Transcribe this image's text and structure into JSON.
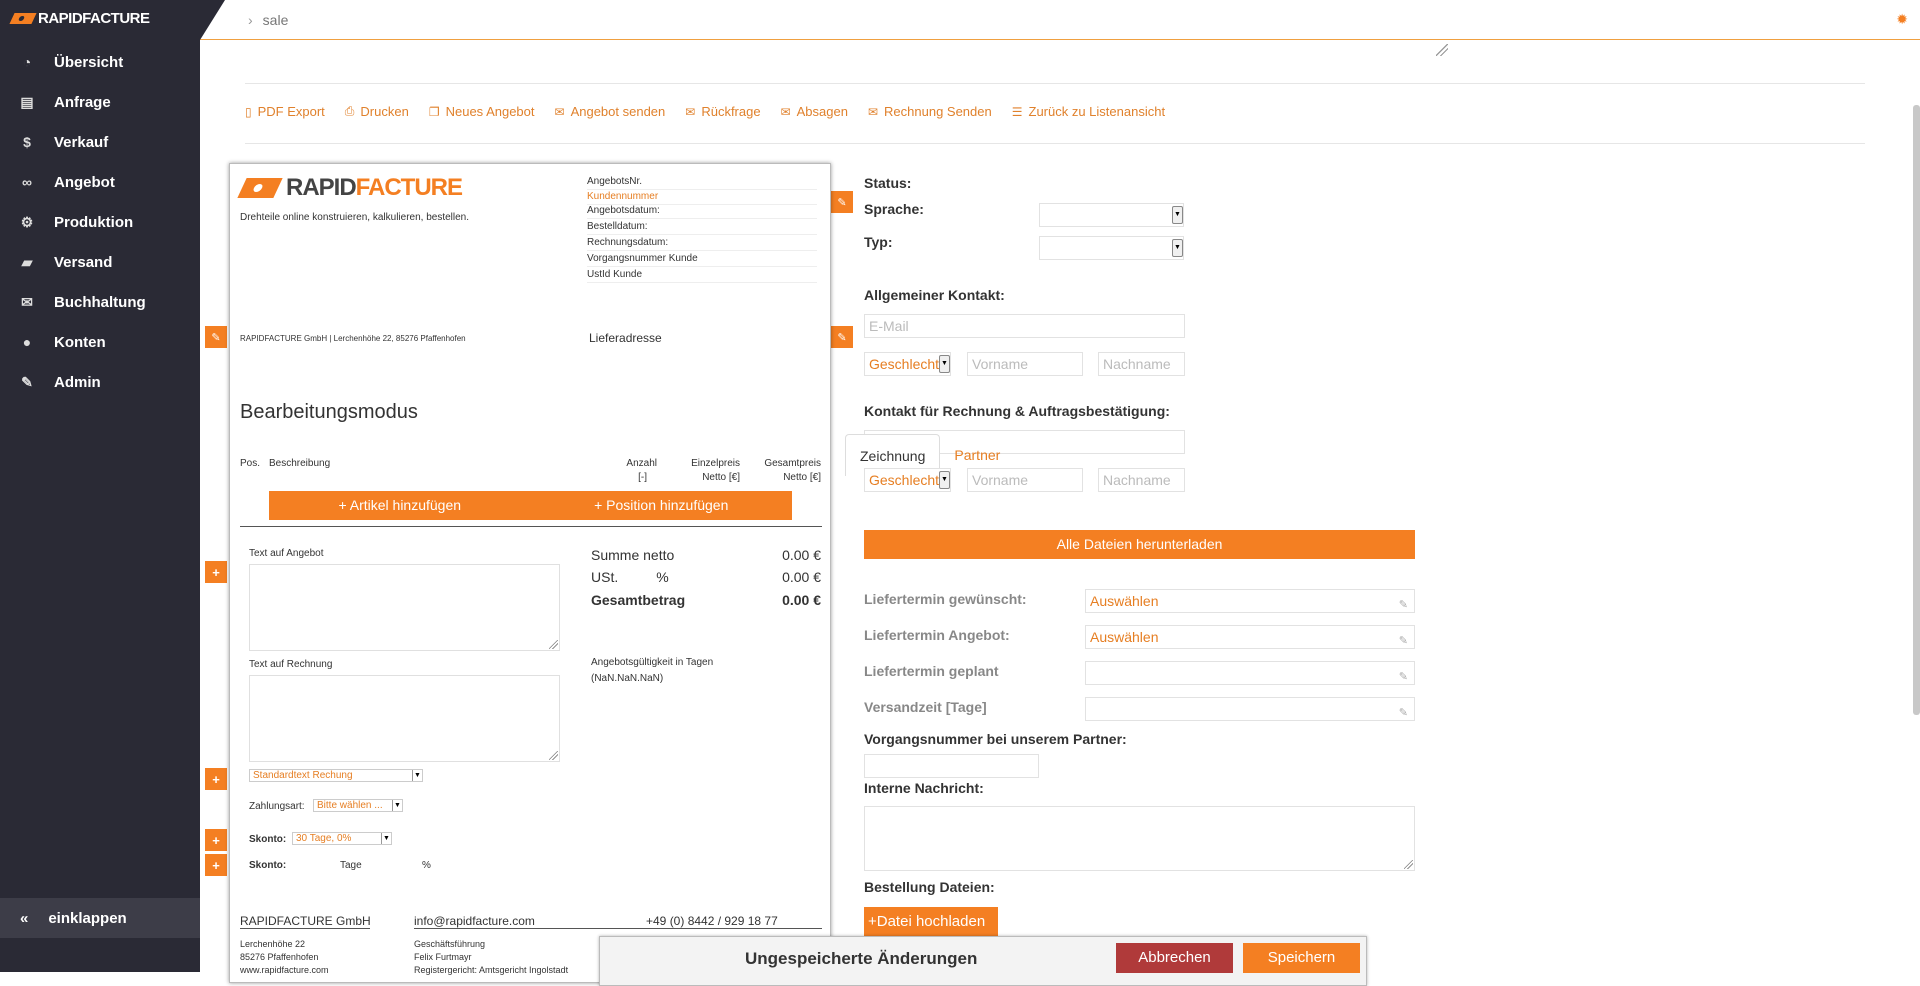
{
  "app": {
    "logo_text": "RAPIDFACTURE"
  },
  "sidebar": {
    "items": [
      {
        "label": "Übersicht",
        "icon": "pie-chart-icon"
      },
      {
        "label": "Anfrage",
        "icon": "file-icon"
      },
      {
        "label": "Verkauf",
        "icon": "dollar-icon"
      },
      {
        "label": "Angebot",
        "icon": "link-icon"
      },
      {
        "label": "Produktion",
        "icon": "gears-icon"
      },
      {
        "label": "Versand",
        "icon": "truck-icon"
      },
      {
        "label": "Buchhaltung",
        "icon": "envelope-icon"
      },
      {
        "label": "Konten",
        "icon": "user-icon"
      },
      {
        "label": "Admin",
        "icon": "wrench-icon"
      }
    ],
    "collapse_label": "einklappen"
  },
  "topbar": {
    "breadcrumb": "sale"
  },
  "actions": [
    {
      "label": "PDF Export",
      "icon": "pdf-icon"
    },
    {
      "label": "Drucken",
      "icon": "print-icon"
    },
    {
      "label": "Neues Angebot",
      "icon": "copy-icon"
    },
    {
      "label": "Angebot senden",
      "icon": "envelope-icon"
    },
    {
      "label": "Rückfrage",
      "icon": "envelope-icon"
    },
    {
      "label": "Absagen",
      "icon": "envelope-icon"
    },
    {
      "label": "Rechnung Senden",
      "icon": "envelope-icon"
    },
    {
      "label": "Zurück zu Listenansicht",
      "icon": "list-icon"
    }
  ],
  "document": {
    "logo_text_dark": "RAPID",
    "logo_text_orange": "FACTURE",
    "tagline": "Drehteile online konstruieren, kalkulieren, bestellen.",
    "meta": {
      "angebotsnr": "AngebotsNr.",
      "kundennummer": "Kundennummer",
      "angebotsdatum": "Angebotsdatum:",
      "bestelldatum": "Bestelldatum:",
      "rechnungsdatum": "Rechnungsdatum:",
      "vorgangsnummer": "Vorgangsnummer Kunde",
      "ustid": "UstId Kunde"
    },
    "sender_line": "RAPIDFACTURE GmbH | Lerchenhöhe 22, 85276 Pfaffenhofen",
    "lieferadresse": "Lieferadresse",
    "mode_title": "Bearbeitungsmodus",
    "table_headers": {
      "pos": "Pos.",
      "beschreibung": "Beschreibung",
      "anzahl": "Anzahl",
      "anzahl_unit": "[-]",
      "einzelpreis": "Einzelpreis",
      "einzelpreis_unit": "Netto [€]",
      "gesamtpreis": "Gesamtpreis",
      "gesamtpreis_unit": "Netto [€]"
    },
    "add_article": "+ Artikel hinzufügen",
    "add_position": "+ Position hinzufügen",
    "text_angebot_label": "Text auf Angebot",
    "text_rechnung_label": "Text auf Rechnung",
    "summary": {
      "netto_label": "Summe netto",
      "netto_value": "0.00 €",
      "ust_label": "USt.",
      "ust_pct": "%",
      "ust_value": "0.00 €",
      "total_label": "Gesamtbetrag",
      "total_value": "0.00 €"
    },
    "validity_label": "Angebotsgültigkeit in Tagen",
    "validity_value": "(NaN.NaN.NaN)",
    "standardtext_select": "Standardtext Rechung",
    "zahlungsart_label": "Zahlungsart:",
    "zahlungsart_select": "Bitte wählen ...",
    "skonto_label": "Skonto:",
    "skonto_select": "30 Tage, 0%",
    "skonto2_label": "Skonto:",
    "skonto2_tage": "Tage",
    "skonto2_pct": "%",
    "footer": {
      "company": "RAPIDFACTURE GmbH",
      "email": "info@rapidfacture.com",
      "phone": "+49 (0) 8442 / 929 18 77",
      "addr1": "Lerchenhöhe 22",
      "addr2": "85276 Pfaffenhofen",
      "web": "www.rapidfacture.com",
      "gf_label": "Geschäftsführung",
      "gf_name": "Felix Furtmayr",
      "register": "Registergericht: Amtsgericht Ingolstadt"
    }
  },
  "form": {
    "status_label": "Status:",
    "sprache_label": "Sprache:",
    "typ_label": "Typ:",
    "allgemeiner_kontakt": "Allgemeiner Kontakt:",
    "email_placeholder": "E-Mail",
    "geschlecht": "Geschlecht",
    "vorname_placeholder": "Vorname",
    "nachname_placeholder": "Nachname",
    "kontakt_rechnung": "Kontakt für Rechnung & Auftragsbestätigung:",
    "tabs": [
      "Zeichnung",
      "Partner"
    ],
    "download_all": "Alle Dateien herunterladen",
    "liefertermin_gewuenscht": "Liefertermin gewünscht:",
    "liefertermin_angebot": "Liefertermin Angebot:",
    "liefertermin_geplant": "Liefertermin geplant",
    "versandzeit": "Versandzeit [Tage]",
    "auswaehlen": "Auswählen",
    "vorgangsnummer_partner": "Vorgangsnummer bei unserem Partner:",
    "interne_nachricht": "Interne Nachricht:",
    "bestellung_dateien": "Bestellung Dateien:",
    "upload": "+Datei hochladen"
  },
  "unsaved": {
    "title": "Ungespeicherte Änderungen",
    "cancel": "Abbrechen",
    "save": "Speichern"
  },
  "colors": {
    "accent": "#f47f22",
    "sidebar": "#2a2a35",
    "danger": "#b03a3a"
  }
}
